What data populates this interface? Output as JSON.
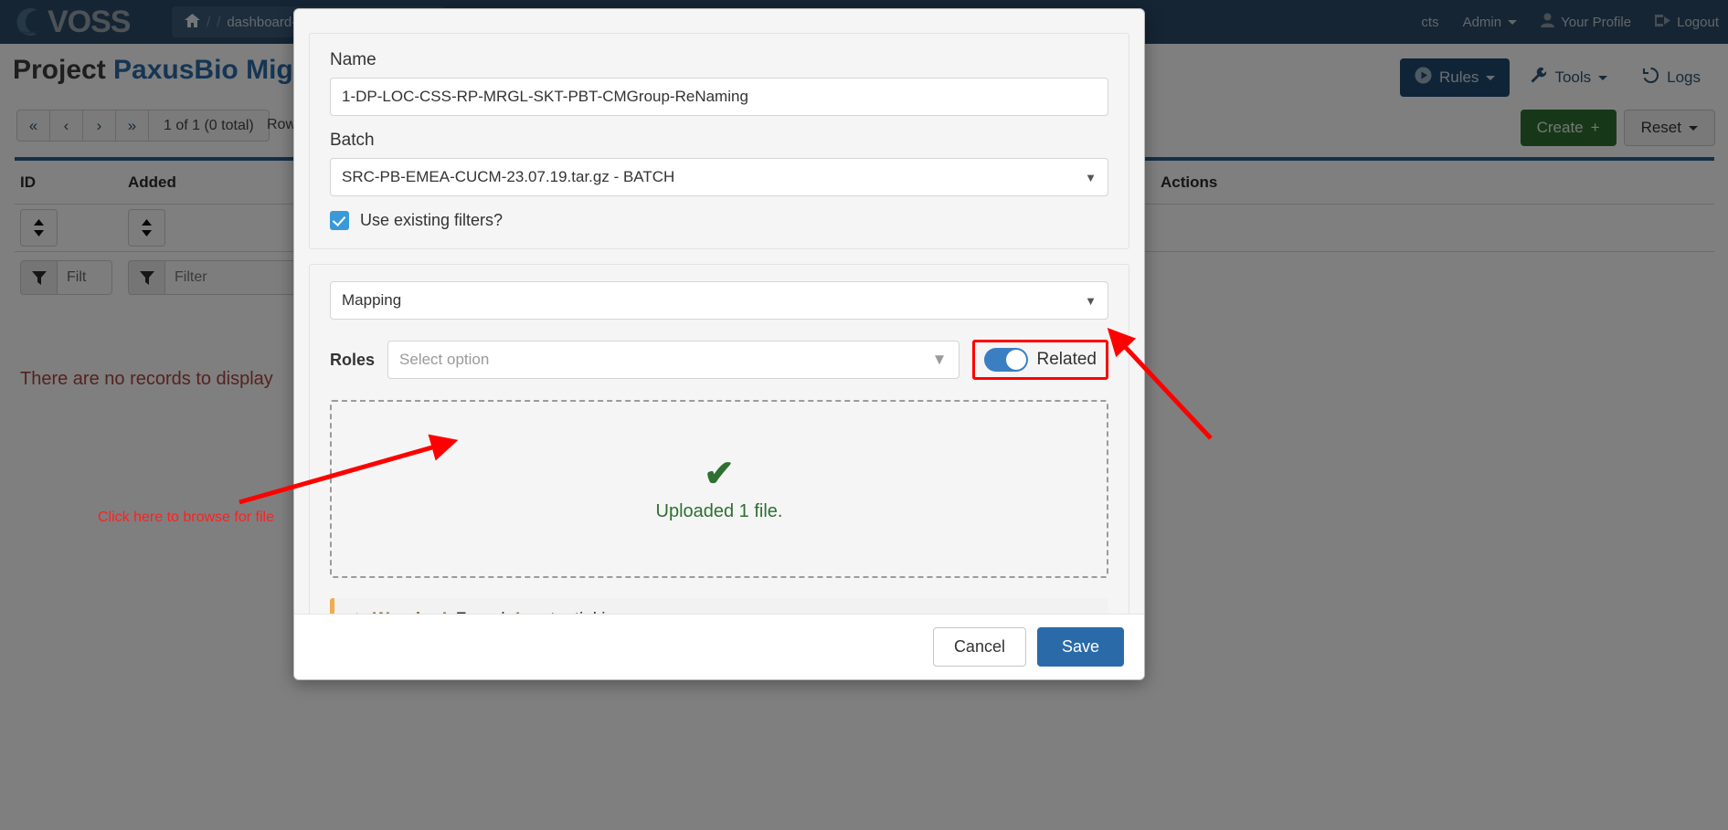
{
  "navbar": {
    "brand": "VOSS",
    "breadcrumb": {
      "home_icon": "home-icon",
      "sep": "/",
      "path": "dashboard-rule"
    },
    "items": [
      {
        "label": "cts",
        "icon": ""
      },
      {
        "label": "Admin",
        "icon": "chevron-down-icon"
      },
      {
        "label": "Your Profile",
        "icon": "user-icon"
      },
      {
        "label": "Logout",
        "icon": "logout-icon"
      }
    ]
  },
  "page": {
    "title_prefix": "Project ",
    "title_name": "PaxusBio Migration"
  },
  "toolbar": {
    "rules": "Rules",
    "tools": "Tools",
    "logs": "Logs",
    "create": "Create",
    "reset": "Reset"
  },
  "pager": {
    "first": "«",
    "prev": "‹",
    "next": "›",
    "last": "»",
    "status": "1 of 1 (0 total)",
    "rows_label": "Rows"
  },
  "grid": {
    "columns": [
      "ID",
      "Added",
      "Actions"
    ],
    "filter_values": [
      "Filt",
      "Filter"
    ],
    "filter_placeholder": "Filter",
    "empty_message": "There are no records to display"
  },
  "modal": {
    "name_label": "Name",
    "name_value": "1-DP-LOC-CSS-RP-MRGL-SKT-PBT-CMGroup-ReNaming",
    "batch_label": "Batch",
    "batch_value": "SRC-PB-EMEA-CUCM-23.07.19.tar.gz - BATCH",
    "use_filters_label": "Use existing filters?",
    "use_filters_checked": true,
    "mapping_value": "Mapping",
    "roles_label": "Roles",
    "roles_placeholder": "Select option",
    "related_label": "Related",
    "related_on": true,
    "upload_check_icon": "check-icon",
    "upload_text": "Uploaded 1 file.",
    "warning_icon": "warning-triangle-icon",
    "warning_bold": "Warning!",
    "warning_pre": "Found ",
    "warning_count": "1",
    "warning_post": " potential issue.",
    "cancel": "Cancel",
    "save": "Save"
  },
  "annotations": {
    "browse_hint": "Click here to browse for file"
  },
  "colors": {
    "navy": "#2b4b68",
    "link_blue": "#2b6aa8",
    "green": "#2e7031",
    "warning": "#8a6d3b",
    "annotation_red": "#ff0000",
    "danger_text": "#a94442",
    "toggle_on": "#3a7fc1"
  }
}
